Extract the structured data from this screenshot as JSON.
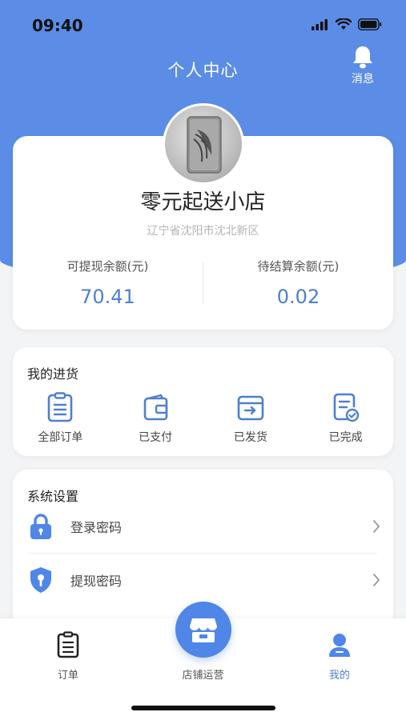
{
  "status_bar": {
    "time": "09:40"
  },
  "header": {
    "title": "个人中心",
    "message_label": "消息"
  },
  "profile": {
    "shop_name": "零元起送小店",
    "address": "辽宁省沈阳市沈北新区",
    "balances": [
      {
        "label": "可提现余额(元)",
        "value": "70.41"
      },
      {
        "label": "待结算余额(元)",
        "value": "0.02"
      }
    ]
  },
  "purchase": {
    "title": "我的进货",
    "items": [
      {
        "label": "全部订单",
        "icon": "clipboard-list-icon"
      },
      {
        "label": "已支付",
        "icon": "wallet-icon"
      },
      {
        "label": "已发货",
        "icon": "box-send-icon"
      },
      {
        "label": "已完成",
        "icon": "doc-check-icon"
      }
    ]
  },
  "settings": {
    "title": "系统设置",
    "rows": [
      {
        "label": "登录密码",
        "icon": "lock-icon"
      },
      {
        "label": "提现密码",
        "icon": "shield-key-icon"
      }
    ]
  },
  "tab_bar": {
    "tabs": [
      {
        "label": "订单",
        "icon": "order-clipboard-icon"
      },
      {
        "label": "店铺运营",
        "icon": "store-icon"
      },
      {
        "label": "我的",
        "icon": "user-icon"
      }
    ],
    "active_color": "#4f7fcf"
  },
  "colors": {
    "primary": "#5b8de6",
    "accent": "#4f86e8"
  }
}
